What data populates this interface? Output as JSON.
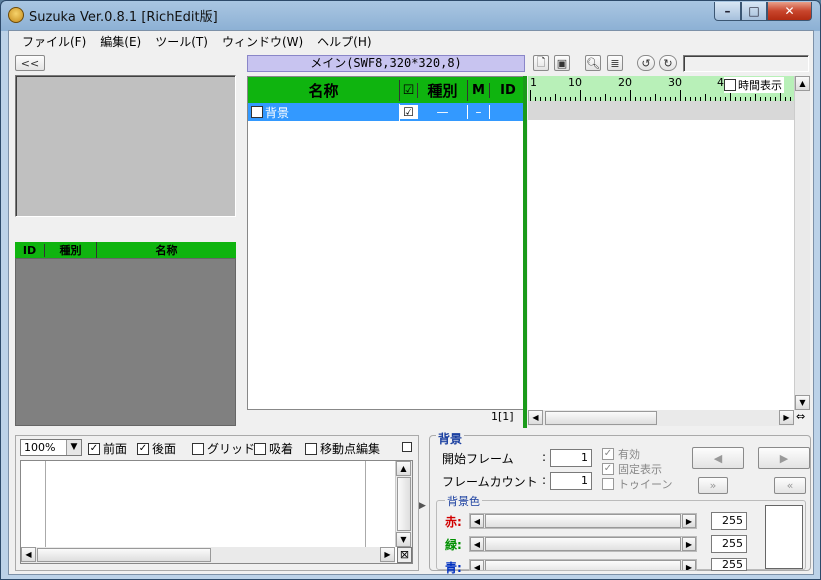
{
  "window": {
    "title": "Suzuka Ver.0.8.1 [RichEdit版]",
    "min": "–",
    "max": "□",
    "close": "✕"
  },
  "menu": [
    "ファイル(F)",
    "編集(E)",
    "ツール(T)",
    "ウィンドウ(W)",
    "ヘルプ(H)"
  ],
  "left": {
    "collapse_label": "<<",
    "list_headers": {
      "id": "ID",
      "type": "種別",
      "name": "名称"
    }
  },
  "scene": {
    "title": "メイン(SWF8,320*320,8)",
    "headers": {
      "name": "名称",
      "check": "☑",
      "type": "種別",
      "m": "M",
      "id": "ID"
    },
    "rows": [
      {
        "name": "背景",
        "checked": "☑",
        "type": "—",
        "m": "–",
        "id": ""
      }
    ],
    "footer": "1[1]"
  },
  "timeline": {
    "ruler": [
      "1",
      "10",
      "20",
      "30",
      "4"
    ],
    "time_display": "時間表示"
  },
  "bottom_left": {
    "zoom": "100%",
    "front": "前面",
    "back": "後面",
    "grid": "グリッド",
    "snap": "吸着",
    "move_edit": "移動点編集"
  },
  "props": {
    "title": "背景",
    "start_frame_label": "開始フレーム",
    "start_frame": "1",
    "frame_count_label": "フレームカウント",
    "frame_count": "1",
    "enabled": "有効",
    "fixed": "固定表示",
    "tween": "トゥイーン",
    "bg_color": "背景色",
    "red": "赤:",
    "green": "緑:",
    "blue": "青:",
    "r": "255",
    "g": "255",
    "b": "255",
    "colors": {
      "red": "#d00000",
      "green": "#009000",
      "blue": "#0030c0"
    }
  },
  "colors": {
    "accent_green": "#0fb40f",
    "selection": "#3399ff"
  }
}
